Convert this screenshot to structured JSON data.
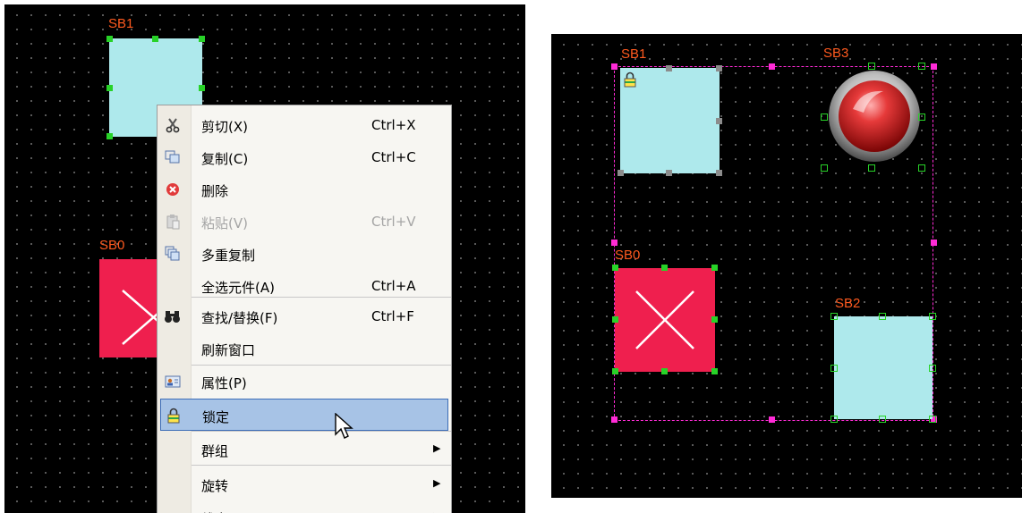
{
  "left_canvas": {
    "labels": {
      "sb1": "SB1",
      "sb0": "SB0"
    }
  },
  "context_menu": {
    "items": [
      {
        "label": "剪切(X)",
        "shortcut": "Ctrl+X",
        "icon": "scissors-icon"
      },
      {
        "label": "复制(C)",
        "shortcut": "Ctrl+C",
        "icon": "copy-icon"
      },
      {
        "label": "删除",
        "shortcut": "",
        "icon": "delete-icon"
      },
      {
        "label": "粘贴(V)",
        "shortcut": "Ctrl+V",
        "icon": "paste-icon",
        "disabled": true
      },
      {
        "label": "多重复制",
        "shortcut": "",
        "icon": "multi-copy-icon"
      },
      {
        "label": "全选元件(A)",
        "shortcut": "Ctrl+A",
        "icon": ""
      },
      {
        "label": "查找/替换(F)",
        "shortcut": "Ctrl+F",
        "icon": "binoculars-icon"
      },
      {
        "label": "刷新窗口",
        "shortcut": "",
        "icon": ""
      },
      {
        "label": "属性(P)",
        "shortcut": "",
        "icon": "properties-icon"
      },
      {
        "label": "锁定",
        "shortcut": "",
        "icon": "lock-icon",
        "highlighted": true
      },
      {
        "label": "群组",
        "shortcut": "",
        "icon": "",
        "submenu": true
      },
      {
        "label": "旋转",
        "shortcut": "",
        "icon": "",
        "submenu": true
      },
      {
        "label": "线宽",
        "shortcut": "",
        "icon": "",
        "submenu": true
      }
    ]
  },
  "right_canvas": {
    "labels": {
      "sb1": "SB1",
      "sb3": "SB3",
      "sb0": "SB0",
      "sb2": "SB2"
    }
  },
  "colors": {
    "label": "#ff5a1f",
    "cyan_element": "#aee9ec",
    "red_element": "#ef1f4e",
    "selection": "#ff2bd6",
    "handle_green": "#28d228",
    "menu_highlight": "#a7c3e6"
  }
}
